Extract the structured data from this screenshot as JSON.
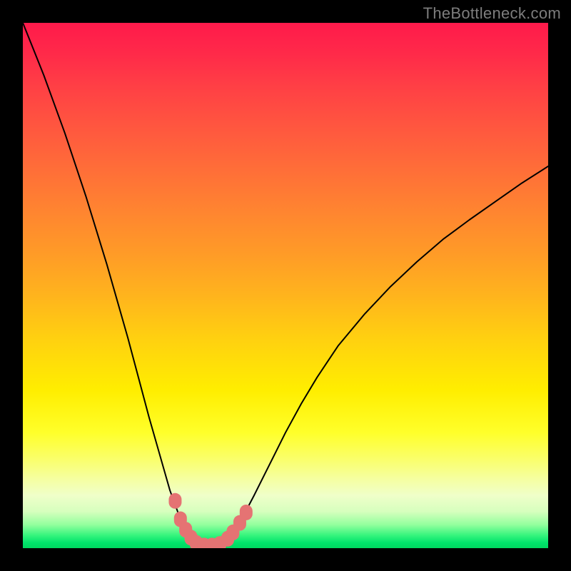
{
  "watermark": "TheBottleneck.com",
  "chart_data": {
    "type": "line",
    "title": "",
    "xlabel": "",
    "ylabel": "",
    "xlim": [
      0,
      1
    ],
    "ylim": [
      0,
      1
    ],
    "grid": false,
    "y_axis_inverted_visually": true,
    "note": "Curve shows a bottleneck metric that drops to ~0 at x≈0.35 and rises on both sides; y is plotted with 0 at the bottom (green) and 1 at the top (red).",
    "series": [
      {
        "name": "bottleneck-curve",
        "color": "#000000",
        "x": [
          0.0,
          0.02,
          0.04,
          0.06,
          0.08,
          0.1,
          0.12,
          0.14,
          0.16,
          0.18,
          0.2,
          0.22,
          0.24,
          0.26,
          0.28,
          0.3,
          0.31,
          0.32,
          0.33,
          0.34,
          0.35,
          0.36,
          0.37,
          0.38,
          0.39,
          0.4,
          0.41,
          0.42,
          0.44,
          0.46,
          0.48,
          0.5,
          0.53,
          0.56,
          0.6,
          0.65,
          0.7,
          0.75,
          0.8,
          0.85,
          0.9,
          0.95,
          1.0
        ],
        "y": [
          1.0,
          0.95,
          0.9,
          0.845,
          0.79,
          0.73,
          0.67,
          0.605,
          0.54,
          0.47,
          0.4,
          0.325,
          0.25,
          0.18,
          0.11,
          0.055,
          0.035,
          0.02,
          0.01,
          0.005,
          0.003,
          0.003,
          0.005,
          0.01,
          0.018,
          0.03,
          0.045,
          0.062,
          0.1,
          0.14,
          0.18,
          0.22,
          0.275,
          0.325,
          0.385,
          0.445,
          0.498,
          0.545,
          0.588,
          0.625,
          0.66,
          0.695,
          0.727
        ]
      }
    ],
    "highlights": [
      {
        "name": "valley-points",
        "color": "#e57373",
        "shape": "rounded-rect",
        "x": [
          0.29,
          0.3,
          0.31,
          0.32,
          0.33,
          0.345,
          0.36,
          0.375,
          0.39,
          0.4,
          0.413,
          0.425
        ],
        "y": [
          0.09,
          0.055,
          0.035,
          0.02,
          0.01,
          0.005,
          0.005,
          0.008,
          0.018,
          0.03,
          0.048,
          0.068
        ]
      }
    ],
    "background_gradient": {
      "direction": "top-to-bottom",
      "stops": [
        {
          "pos": 0.0,
          "color": "#ff1a4b"
        },
        {
          "pos": 0.7,
          "color": "#ffee00"
        },
        {
          "pos": 0.97,
          "color": "#38f57e"
        },
        {
          "pos": 1.0,
          "color": "#00d85f"
        }
      ]
    }
  }
}
